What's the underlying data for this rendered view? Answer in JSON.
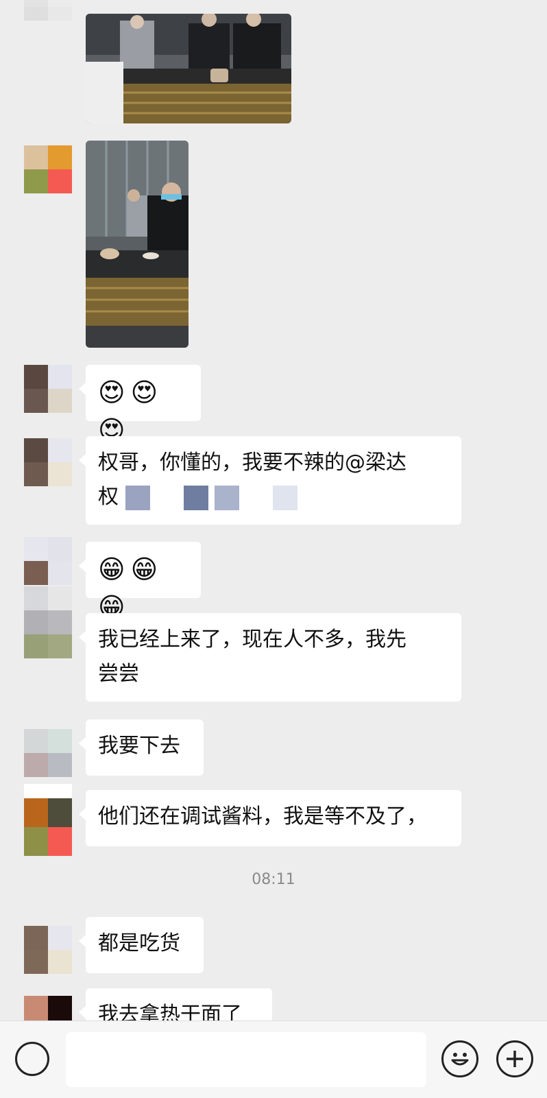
{
  "messages": {
    "m3": {
      "emojis": "😍😍😍"
    },
    "m4": {
      "line1": "权哥，你懂的，我要不辣的@梁达",
      "line2": "权"
    },
    "m5": {
      "emojis": "😁😁😁"
    },
    "m6": {
      "line1": "我已经上来了，现在人不多，我先",
      "line2": "尝尝"
    },
    "m7": {
      "text": "我要下去"
    },
    "m8": {
      "text": "他们还在调试酱料，我是等不及了，"
    },
    "m9": {
      "text": "都是吃货"
    },
    "m10": {
      "text": "我去拿热干面了"
    }
  },
  "timestamp": "08:11",
  "input": {
    "placeholder": ""
  },
  "icons": {
    "voice": "voice-icon",
    "emoji": "emoji-face-icon",
    "plus": "plus-icon"
  },
  "colors": {
    "background": "#ededed",
    "bubble": "#ffffff",
    "timestamp": "#8a8a8a"
  }
}
